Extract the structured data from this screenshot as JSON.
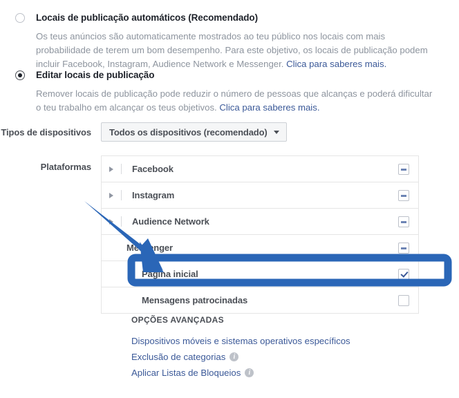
{
  "options": [
    {
      "id": "automatic-placements",
      "title": "Locais de publicação automáticos (Recomendado)",
      "selected": false,
      "description_part1": "Os teus anúncios são automaticamente mostrados ao teu público nos locais com mais probabilidade de terem um bom desempenho. Para este objetivo, os locais de publicação podem incluir Facebook, Instagram, Audience Network e Messenger. ",
      "link_text": "Clica para saberes mais.",
      "description_part2": ""
    },
    {
      "id": "edit-placements",
      "title": "Editar locais de publicação",
      "selected": true,
      "description_part1": "Remover locais de publicação pode reduzir o número de pessoas que alcanças e poderá dificultar o teu trabalho em alcançar os teus objetivos. ",
      "link_text": "Clica para saberes mais.",
      "description_part2": ""
    }
  ],
  "device_types": {
    "label": "Tipos de dispositivos",
    "value": "Todos os dispositivos (recomendado)",
    "caret_icon": "chevron-down-icon"
  },
  "platforms": {
    "label": "Plataformas",
    "rows": [
      {
        "name": "Facebook",
        "level": "top",
        "expanded": false,
        "control": "minus",
        "has_disclosure": true
      },
      {
        "name": "Instagram",
        "level": "top",
        "expanded": false,
        "control": "minus",
        "has_disclosure": true
      },
      {
        "name": "Audience Network",
        "level": "top",
        "expanded": false,
        "control": "minus",
        "has_disclosure": true
      },
      {
        "name": "Messenger",
        "level": "top",
        "expanded": true,
        "control": "minus",
        "has_disclosure": false
      },
      {
        "name": "Página inicial",
        "level": "sub",
        "expanded": false,
        "control": "checkbox-checked",
        "has_disclosure": false
      },
      {
        "name": "Mensagens patrocinadas",
        "level": "sub",
        "expanded": false,
        "control": "checkbox",
        "has_disclosure": false
      }
    ]
  },
  "advanced_options": {
    "title": "OPÇÕES AVANÇADAS",
    "links": [
      {
        "text": "Dispositivos móveis e sistemas operativos específicos",
        "info": false
      },
      {
        "text": "Exclusão de categorias",
        "info": true
      },
      {
        "text": "Aplicar Listas de Bloqueios",
        "info": true
      }
    ]
  },
  "annotation": {
    "color": "#2a66b7",
    "arrow_name": "blue-annotation-arrow",
    "highlight_name": "blue-highlight-rectangle",
    "highlighted_row": "Página inicial"
  }
}
